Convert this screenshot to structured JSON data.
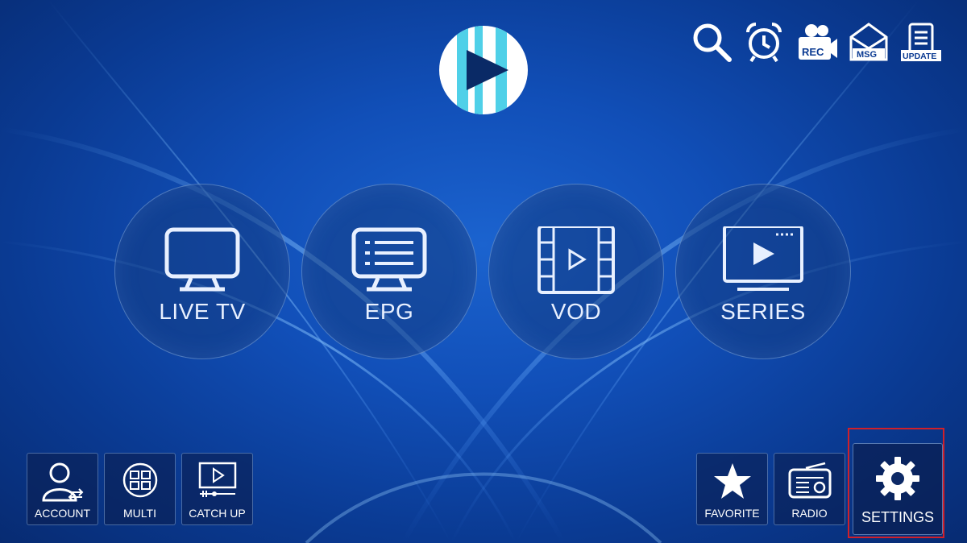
{
  "main_menu": [
    {
      "label": "LIVE TV",
      "icon": "tv-icon"
    },
    {
      "label": "EPG",
      "icon": "epg-guide-icon"
    },
    {
      "label": "VOD",
      "icon": "film-play-icon"
    },
    {
      "label": "SERIES",
      "icon": "series-play-icon"
    }
  ],
  "top_bar": {
    "search": {
      "icon": "search-icon"
    },
    "alarm": {
      "icon": "alarm-clock-icon"
    },
    "rec": {
      "label": "REC",
      "icon": "record-camera-icon"
    },
    "msg": {
      "label": "MSG",
      "icon": "message-envelope-icon"
    },
    "update": {
      "label": "UPDATE",
      "icon": "update-clipboard-icon"
    }
  },
  "bottom_left": [
    {
      "label": "ACCOUNT",
      "icon": "account-user-icon"
    },
    {
      "label": "MULTI",
      "icon": "multi-screen-icon"
    },
    {
      "label": "CATCH UP",
      "icon": "catch-up-player-icon"
    }
  ],
  "bottom_right": [
    {
      "label": "FAVORITE",
      "icon": "star-icon"
    },
    {
      "label": "RADIO",
      "icon": "radio-icon"
    }
  ],
  "settings": {
    "label": "SETTINGS",
    "icon": "gear-icon",
    "highlight_color": "#d0202a"
  },
  "colors": {
    "background": "#114fb8",
    "accent": "#4fd0e8"
  }
}
